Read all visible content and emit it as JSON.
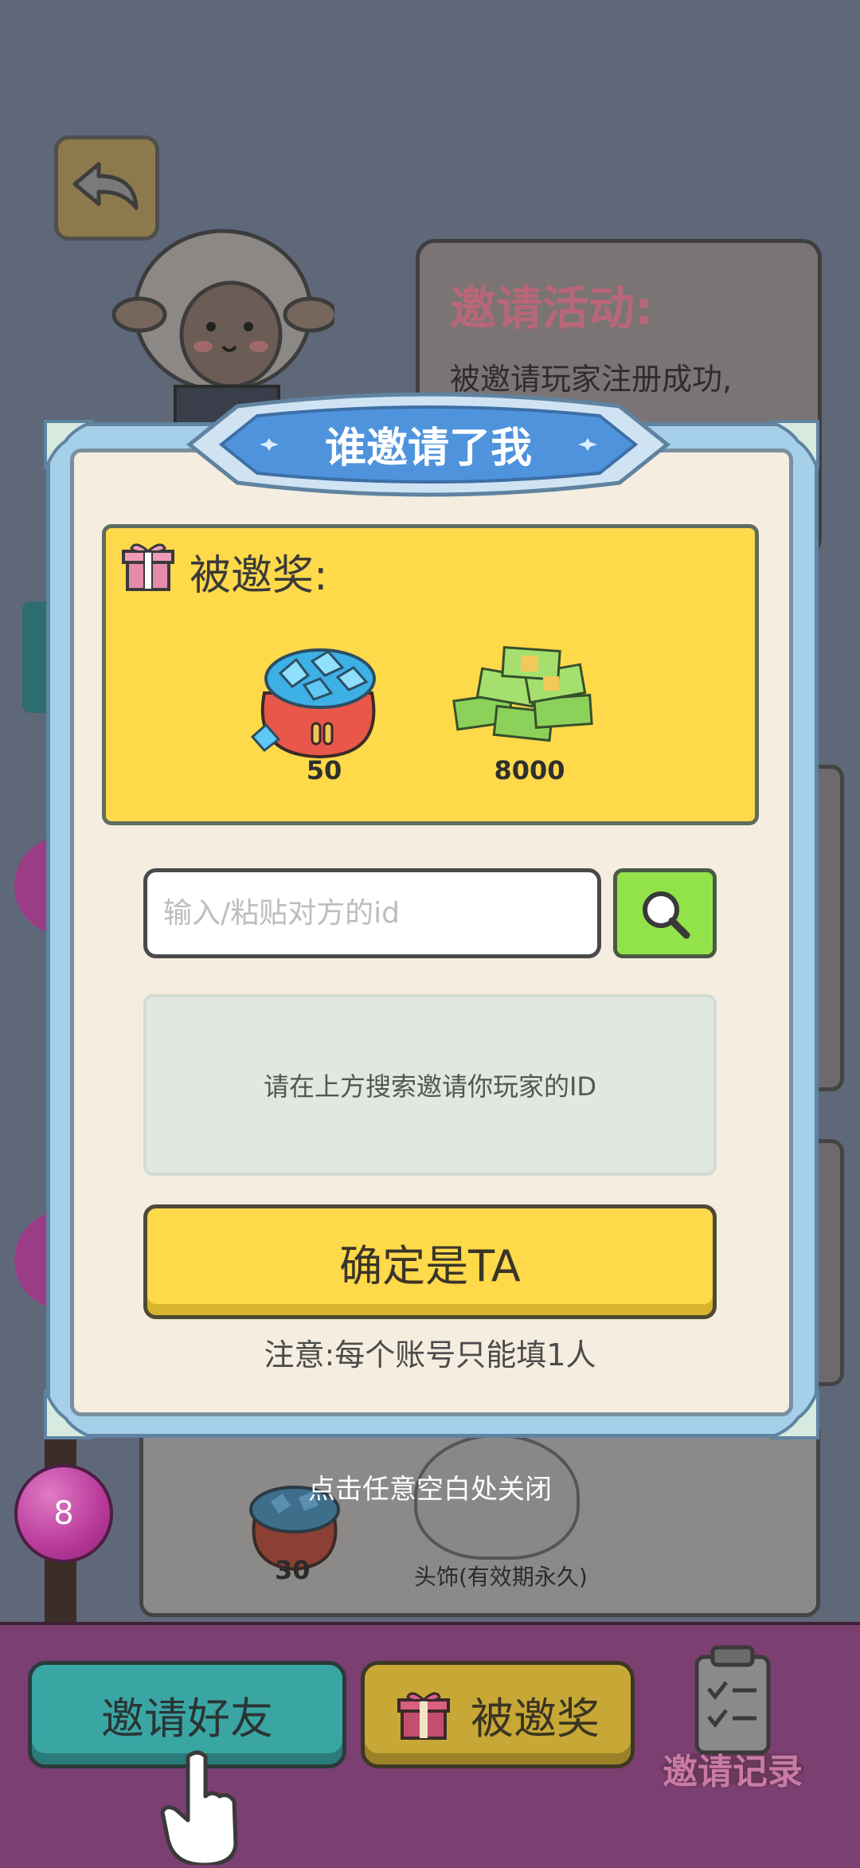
{
  "event": {
    "title": "邀请活动:",
    "text": "被邀请玩家注册成功,"
  },
  "dialog": {
    "title": "谁邀请了我",
    "reward_title": "被邀奖:",
    "rewards": [
      {
        "icon": "diamond-bag-icon",
        "value": "50"
      },
      {
        "icon": "cash-stack-icon",
        "value": "8000"
      }
    ],
    "input_placeholder": "输入/粘贴对方的id",
    "input_value": "",
    "result_hint": "请在上方搜索邀请你玩家的ID",
    "confirm_label": "确定是TA",
    "note": "注意:每个账号只能填1人"
  },
  "tap_hint": "点击任意空白处关闭",
  "background_list": {
    "level": "8",
    "item1_value": "30",
    "item2_label": "头饰(有效期永久)"
  },
  "bottom_bar": {
    "invite_label": "邀请好友",
    "rewarded_label": "被邀奖",
    "record_label": "邀请记录"
  },
  "colors": {
    "reward_box": "#fed94a",
    "search_button": "#92e349",
    "dialog_frame": "#a6cfe9",
    "bottom_bar": "#7c3f72"
  }
}
